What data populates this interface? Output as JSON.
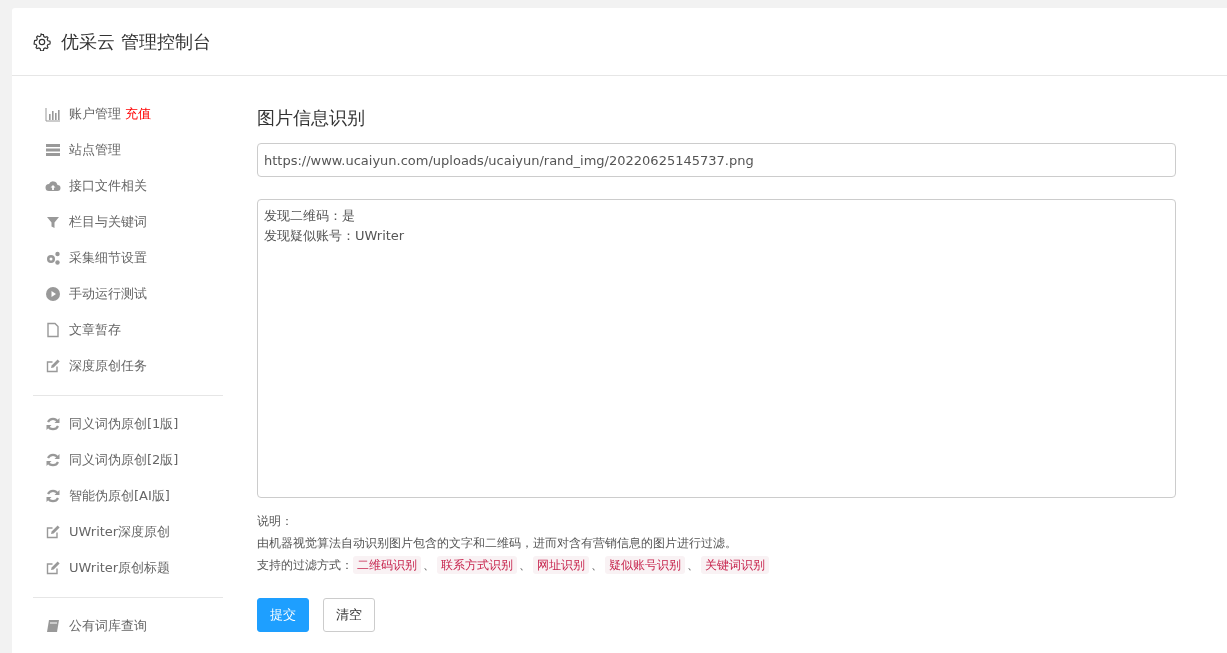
{
  "header": {
    "title": "优采云 管理控制台"
  },
  "sidebar": {
    "sections": [
      [
        {
          "kind": "chart",
          "label": "账户管理",
          "badge": "充值"
        },
        {
          "kind": "server",
          "label": "站点管理"
        },
        {
          "kind": "cloud",
          "label": "接口文件相关"
        },
        {
          "kind": "filter",
          "label": "栏目与关键词"
        },
        {
          "kind": "gears",
          "label": "采集细节设置"
        },
        {
          "kind": "play",
          "label": "手动运行测试"
        },
        {
          "kind": "doc",
          "label": "文章暂存"
        },
        {
          "kind": "edit",
          "label": "深度原创任务"
        }
      ],
      [
        {
          "kind": "refresh",
          "label": "同义词伪原创[1版]"
        },
        {
          "kind": "refresh",
          "label": "同义词伪原创[2版]"
        },
        {
          "kind": "refresh",
          "label": "智能伪原创[AI版]"
        },
        {
          "kind": "edit",
          "label": "UWriter深度原创"
        },
        {
          "kind": "edit",
          "label": "UWriter原创标题"
        }
      ],
      [
        {
          "kind": "book",
          "label": "公有词库查询"
        }
      ]
    ]
  },
  "main": {
    "title": "图片信息识别",
    "url_field": {
      "value": "https://www.ucaiyun.com/uploads/ucaiyun/rand_img/20220625145737.png"
    },
    "result_box": {
      "lines": [
        "发现二维码：是",
        "发现疑似账号：UWriter"
      ]
    },
    "note": {
      "heading": "说明：",
      "description": "由机器视觉算法自动识别图片包含的文字和二维码，进而对含有营销信息的图片进行过滤。",
      "methods_label": "支持的过滤方式：",
      "separator": "、",
      "methods": [
        "二维码识别",
        "联系方式识别",
        "网址识别",
        "疑似账号识别",
        "关键词识别"
      ]
    },
    "buttons": [
      {
        "kind": "primary",
        "label": "提交"
      },
      {
        "kind": "default",
        "label": "清空"
      }
    ]
  }
}
